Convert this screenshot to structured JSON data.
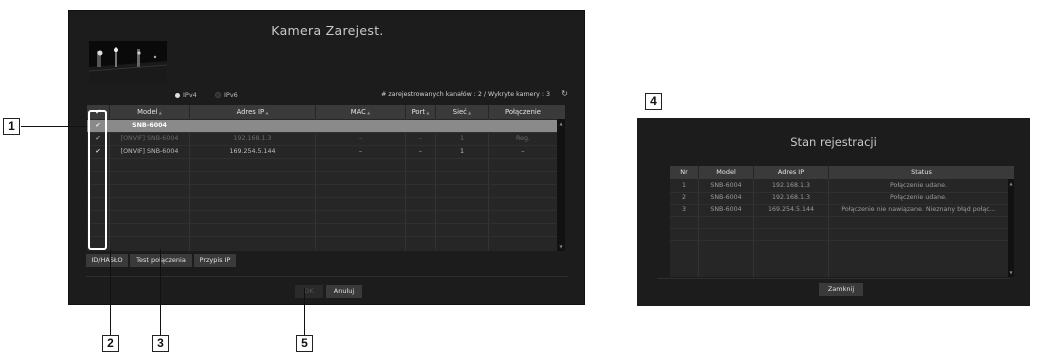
{
  "main_dialog": {
    "title": "Kamera Zarejest.",
    "radio_ipv4": "IPv4",
    "radio_ipv6": "IPv6",
    "registered_info": "# zarejestrowanych kanałów : 2 / Wykryte kamery : 3",
    "columns": [
      "Model",
      "Adres IP",
      "MAC",
      "Port",
      "Sieć",
      "Połączenie"
    ],
    "rows": [
      {
        "model": "SNB-6004",
        "ip": "",
        "mac": "",
        "port": "",
        "net": "",
        "conn": ""
      },
      {
        "model": "[ONVIF] SNB-6004",
        "ip": "192.168.1.3",
        "mac": "–",
        "port": "–",
        "net": "1",
        "conn": "Reg."
      },
      {
        "model": "[ONVIF] SNB-6004",
        "ip": "169.254.5.144",
        "mac": "–",
        "port": "–",
        "net": "1",
        "conn": "–"
      }
    ],
    "btn_id": "ID/HASŁO",
    "btn_test": "Test połączenia",
    "btn_ip": "Przypis IP",
    "btn_ok": "OK",
    "btn_cancel": "Anuluj"
  },
  "status_dialog": {
    "title": "Stan rejestracji",
    "columns": [
      "Nr",
      "Model",
      "Adres IP",
      "Status"
    ],
    "rows": [
      {
        "nr": "1",
        "model": "SNB-6004",
        "ip": "192.168.1.3",
        "status": "Połączenie udane."
      },
      {
        "nr": "2",
        "model": "SNB-6004",
        "ip": "192.168.1.3",
        "status": "Połączenie udane."
      },
      {
        "nr": "3",
        "model": "SNB-6004",
        "ip": "169.254.5.144",
        "status": "Połączenie nie nawiązane. Nieznany błąd połąc..."
      }
    ],
    "btn_close": "Zamknij"
  },
  "callouts": [
    "1",
    "2",
    "3",
    "4",
    "5"
  ],
  "icons": {
    "checkbox": "check-icon",
    "refresh": "refresh-icon",
    "sort": "sort-arrow-icon"
  },
  "colors": {
    "dialog_bg": "#1c1c1c",
    "header_bg": "#3a3a3a",
    "selected_row": "#8a8a8a",
    "checkbox_highlight": "#ffffff"
  }
}
